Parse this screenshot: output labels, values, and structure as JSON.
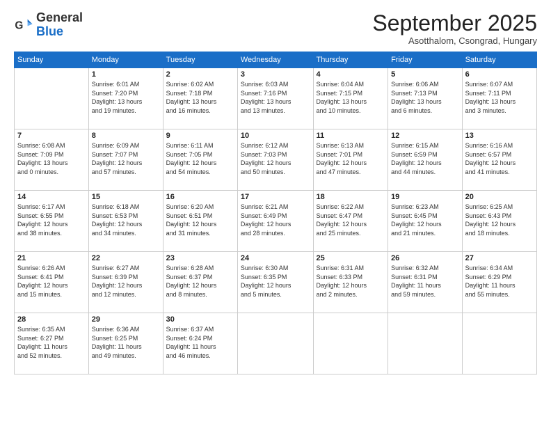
{
  "logo": {
    "general": "General",
    "blue": "Blue"
  },
  "header": {
    "month": "September 2025",
    "location": "Asotthalom, Csongrad, Hungary"
  },
  "days_of_week": [
    "Sunday",
    "Monday",
    "Tuesday",
    "Wednesday",
    "Thursday",
    "Friday",
    "Saturday"
  ],
  "weeks": [
    [
      {
        "day": "",
        "info": ""
      },
      {
        "day": "1",
        "info": "Sunrise: 6:01 AM\nSunset: 7:20 PM\nDaylight: 13 hours\nand 19 minutes."
      },
      {
        "day": "2",
        "info": "Sunrise: 6:02 AM\nSunset: 7:18 PM\nDaylight: 13 hours\nand 16 minutes."
      },
      {
        "day": "3",
        "info": "Sunrise: 6:03 AM\nSunset: 7:16 PM\nDaylight: 13 hours\nand 13 minutes."
      },
      {
        "day": "4",
        "info": "Sunrise: 6:04 AM\nSunset: 7:15 PM\nDaylight: 13 hours\nand 10 minutes."
      },
      {
        "day": "5",
        "info": "Sunrise: 6:06 AM\nSunset: 7:13 PM\nDaylight: 13 hours\nand 6 minutes."
      },
      {
        "day": "6",
        "info": "Sunrise: 6:07 AM\nSunset: 7:11 PM\nDaylight: 13 hours\nand 3 minutes."
      }
    ],
    [
      {
        "day": "7",
        "info": "Sunrise: 6:08 AM\nSunset: 7:09 PM\nDaylight: 13 hours\nand 0 minutes."
      },
      {
        "day": "8",
        "info": "Sunrise: 6:09 AM\nSunset: 7:07 PM\nDaylight: 12 hours\nand 57 minutes."
      },
      {
        "day": "9",
        "info": "Sunrise: 6:11 AM\nSunset: 7:05 PM\nDaylight: 12 hours\nand 54 minutes."
      },
      {
        "day": "10",
        "info": "Sunrise: 6:12 AM\nSunset: 7:03 PM\nDaylight: 12 hours\nand 50 minutes."
      },
      {
        "day": "11",
        "info": "Sunrise: 6:13 AM\nSunset: 7:01 PM\nDaylight: 12 hours\nand 47 minutes."
      },
      {
        "day": "12",
        "info": "Sunrise: 6:15 AM\nSunset: 6:59 PM\nDaylight: 12 hours\nand 44 minutes."
      },
      {
        "day": "13",
        "info": "Sunrise: 6:16 AM\nSunset: 6:57 PM\nDaylight: 12 hours\nand 41 minutes."
      }
    ],
    [
      {
        "day": "14",
        "info": "Sunrise: 6:17 AM\nSunset: 6:55 PM\nDaylight: 12 hours\nand 38 minutes."
      },
      {
        "day": "15",
        "info": "Sunrise: 6:18 AM\nSunset: 6:53 PM\nDaylight: 12 hours\nand 34 minutes."
      },
      {
        "day": "16",
        "info": "Sunrise: 6:20 AM\nSunset: 6:51 PM\nDaylight: 12 hours\nand 31 minutes."
      },
      {
        "day": "17",
        "info": "Sunrise: 6:21 AM\nSunset: 6:49 PM\nDaylight: 12 hours\nand 28 minutes."
      },
      {
        "day": "18",
        "info": "Sunrise: 6:22 AM\nSunset: 6:47 PM\nDaylight: 12 hours\nand 25 minutes."
      },
      {
        "day": "19",
        "info": "Sunrise: 6:23 AM\nSunset: 6:45 PM\nDaylight: 12 hours\nand 21 minutes."
      },
      {
        "day": "20",
        "info": "Sunrise: 6:25 AM\nSunset: 6:43 PM\nDaylight: 12 hours\nand 18 minutes."
      }
    ],
    [
      {
        "day": "21",
        "info": "Sunrise: 6:26 AM\nSunset: 6:41 PM\nDaylight: 12 hours\nand 15 minutes."
      },
      {
        "day": "22",
        "info": "Sunrise: 6:27 AM\nSunset: 6:39 PM\nDaylight: 12 hours\nand 12 minutes."
      },
      {
        "day": "23",
        "info": "Sunrise: 6:28 AM\nSunset: 6:37 PM\nDaylight: 12 hours\nand 8 minutes."
      },
      {
        "day": "24",
        "info": "Sunrise: 6:30 AM\nSunset: 6:35 PM\nDaylight: 12 hours\nand 5 minutes."
      },
      {
        "day": "25",
        "info": "Sunrise: 6:31 AM\nSunset: 6:33 PM\nDaylight: 12 hours\nand 2 minutes."
      },
      {
        "day": "26",
        "info": "Sunrise: 6:32 AM\nSunset: 6:31 PM\nDaylight: 11 hours\nand 59 minutes."
      },
      {
        "day": "27",
        "info": "Sunrise: 6:34 AM\nSunset: 6:29 PM\nDaylight: 11 hours\nand 55 minutes."
      }
    ],
    [
      {
        "day": "28",
        "info": "Sunrise: 6:35 AM\nSunset: 6:27 PM\nDaylight: 11 hours\nand 52 minutes."
      },
      {
        "day": "29",
        "info": "Sunrise: 6:36 AM\nSunset: 6:25 PM\nDaylight: 11 hours\nand 49 minutes."
      },
      {
        "day": "30",
        "info": "Sunrise: 6:37 AM\nSunset: 6:24 PM\nDaylight: 11 hours\nand 46 minutes."
      },
      {
        "day": "",
        "info": ""
      },
      {
        "day": "",
        "info": ""
      },
      {
        "day": "",
        "info": ""
      },
      {
        "day": "",
        "info": ""
      }
    ]
  ]
}
